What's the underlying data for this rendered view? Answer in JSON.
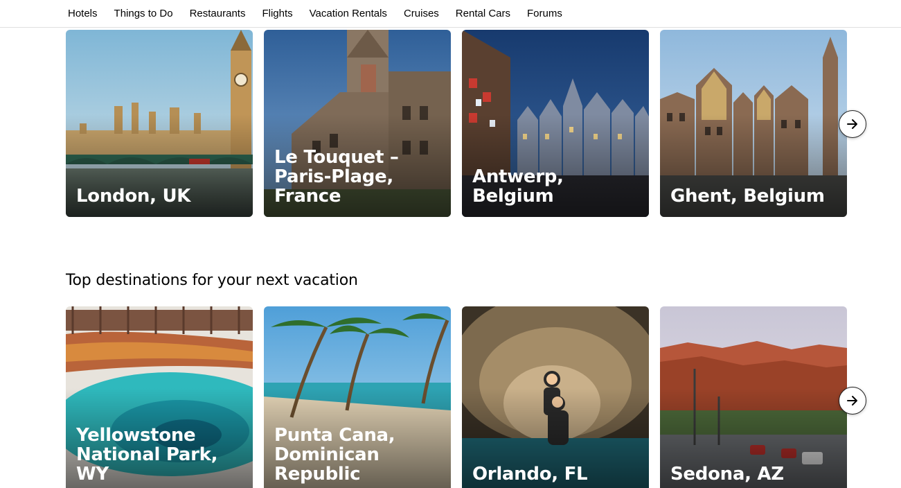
{
  "nav": {
    "items": [
      "Hotels",
      "Things to Do",
      "Restaurants",
      "Flights",
      "Vacation Rentals",
      "Cruises",
      "Rental Cars",
      "Forums"
    ]
  },
  "row1": {
    "cards": [
      {
        "name": "London, UK"
      },
      {
        "name": "Le Touquet – Paris-Plage, France"
      },
      {
        "name": "Antwerp, Belgium"
      },
      {
        "name": "Ghent, Belgium"
      }
    ],
    "next_icon": "arrow-right-icon"
  },
  "row2": {
    "title": "Top destinations for your next vacation",
    "cards": [
      {
        "name": "Yellowstone National Park, WY"
      },
      {
        "name": "Punta Cana, Dominican Republic"
      },
      {
        "name": "Orlando, FL"
      },
      {
        "name": "Sedona, AZ"
      }
    ],
    "next_icon": "arrow-right-icon"
  },
  "colors": {
    "text": "#000000",
    "border": "#e0e0e0",
    "card_text": "#ffffff"
  }
}
